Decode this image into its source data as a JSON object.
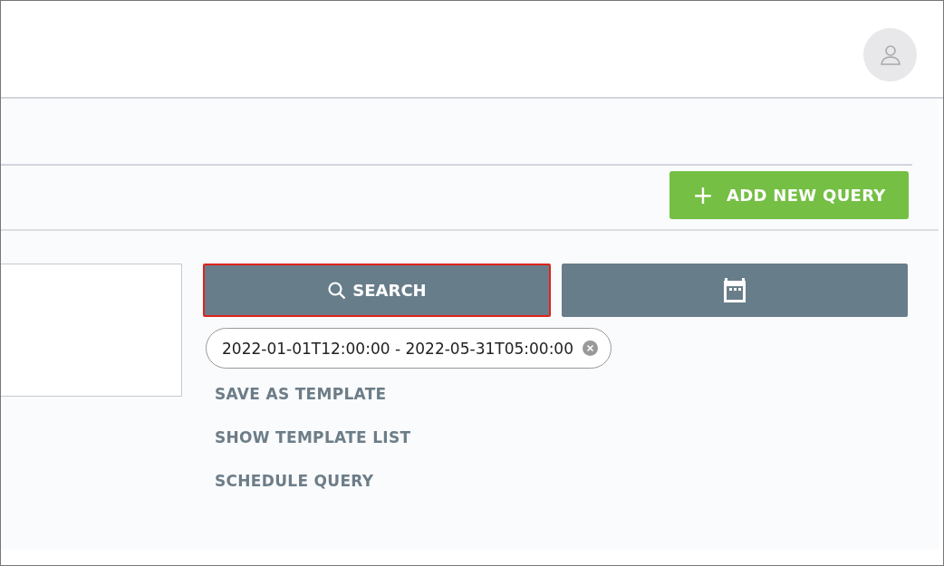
{
  "add_button": {
    "label": "ADD NEW QUERY",
    "icon": "+"
  },
  "search_button": {
    "label": "SEARCH",
    "focused": true
  },
  "date_chip": {
    "label": "2022-01-01T12:00:00 - 2022-05-31T05:00:00"
  },
  "links": [
    "SAVE AS TEMPLATE",
    "SHOW TEMPLATE LIST",
    "SCHEDULE QUERY"
  ]
}
